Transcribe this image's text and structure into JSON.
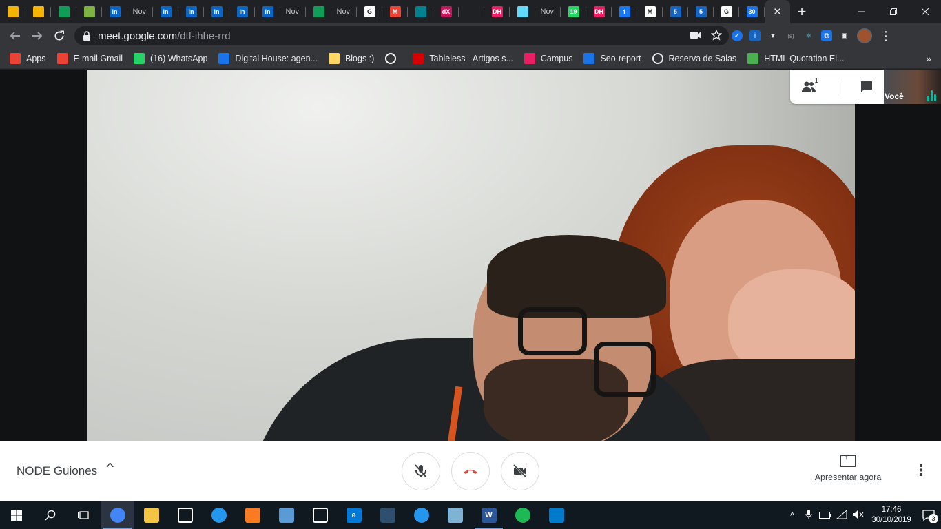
{
  "browser": {
    "tabs": [
      {
        "favicon": "slides-icon",
        "color": "#f4b400",
        "text": ""
      },
      {
        "favicon": "slides-icon",
        "color": "#f4b400",
        "text": ""
      },
      {
        "favicon": "drive-icon",
        "color": "#0f9d58",
        "text": ""
      },
      {
        "favicon": "shield-icon",
        "color": "#7cb342",
        "text": ""
      },
      {
        "favicon": "linkedin-icon",
        "color": "#0a66c2",
        "text": "in"
      },
      {
        "favicon": "none",
        "color": "",
        "text": "Nov"
      },
      {
        "favicon": "linkedin-icon",
        "color": "#0a66c2",
        "text": "in"
      },
      {
        "favicon": "linkedin-icon",
        "color": "#0a66c2",
        "text": "in"
      },
      {
        "favicon": "linkedin-icon",
        "color": "#0a66c2",
        "text": "in"
      },
      {
        "favicon": "linkedin-icon",
        "color": "#0a66c2",
        "text": "in"
      },
      {
        "favicon": "linkedin-icon",
        "color": "#0a66c2",
        "text": "in"
      },
      {
        "favicon": "none",
        "color": "",
        "text": "Nov"
      },
      {
        "favicon": "hangouts-icon",
        "color": "#0f9d58",
        "text": ""
      },
      {
        "favicon": "none",
        "color": "",
        "text": "Nov"
      },
      {
        "favicon": "google-icon",
        "color": "#ffffff",
        "text": "G"
      },
      {
        "favicon": "gmail-icon",
        "color": "#ea4335",
        "text": "M"
      },
      {
        "favicon": "chart-icon",
        "color": "#00838f",
        "text": ""
      },
      {
        "favicon": "edx-icon",
        "color": "#c2185b",
        "text": "dX"
      },
      {
        "favicon": "edit-icon",
        "color": "#202124",
        "text": ""
      },
      {
        "favicon": "dh-icon",
        "color": "#e91e63",
        "text": "DH"
      },
      {
        "favicon": "react-icon",
        "color": "#61dafb",
        "text": ""
      },
      {
        "favicon": "none",
        "color": "",
        "text": "Nov"
      },
      {
        "favicon": "whatsapp-icon",
        "color": "#25d366",
        "text": "19"
      },
      {
        "favicon": "dh-icon",
        "color": "#e91e63",
        "text": "DH"
      },
      {
        "favicon": "facebook-icon",
        "color": "#1877f2",
        "text": "f"
      },
      {
        "favicon": "medium-icon",
        "color": "#ffffff",
        "text": "M"
      },
      {
        "favicon": "doc-icon",
        "color": "#1565c0",
        "text": "5"
      },
      {
        "favicon": "doc-icon",
        "color": "#1565c0",
        "text": "5"
      },
      {
        "favicon": "google-icon",
        "color": "#ffffff",
        "text": "G"
      },
      {
        "favicon": "calendar-icon",
        "color": "#1a73e8",
        "text": "30"
      }
    ],
    "active_tab_close": "✕",
    "new_tab": "+",
    "url_host": "meet.google.com",
    "url_path": "/dtf-ihhe-rrd"
  },
  "bookmarks": [
    {
      "label": "Apps",
      "icon": "apps-grid-icon",
      "color": "#ea4335"
    },
    {
      "label": "E-mail Gmail",
      "icon": "gmail-icon",
      "color": "#ea4335"
    },
    {
      "label": "(16) WhatsApp",
      "icon": "whatsapp-icon",
      "color": "#25d366"
    },
    {
      "label": "Digital House: agen...",
      "icon": "calendar-icon",
      "color": "#1a73e8"
    },
    {
      "label": "Blogs :)",
      "icon": "folder-icon",
      "color": "#fdd663"
    },
    {
      "label": "",
      "icon": "google-icon",
      "color": "#ffffff"
    },
    {
      "label": "Tableless - Artigos s...",
      "icon": "star-icon",
      "color": "#d50000"
    },
    {
      "label": "Campus",
      "icon": "dh-icon",
      "color": "#e91e63"
    },
    {
      "label": "Seo-report",
      "icon": "seo-icon",
      "color": "#1a73e8"
    },
    {
      "label": "Reserva de Salas",
      "icon": "globe-icon",
      "color": "#e8eaed"
    },
    {
      "label": "HTML Quotation El...",
      "icon": "w3-icon",
      "color": "#4caf50"
    }
  ],
  "meet": {
    "participants_count": "1",
    "self_label": "Você",
    "meeting_name": "NODE Guiones",
    "present_label": "Apresentar agora",
    "hangup_color": "#ea4335"
  },
  "taskbar": {
    "apps": [
      {
        "name": "chrome",
        "color": "#4285f4",
        "text": "",
        "running": true,
        "active": true
      },
      {
        "name": "file-explorer",
        "color": "#f4c542",
        "text": "",
        "running": false,
        "active": false
      },
      {
        "name": "mail",
        "color": "#ffffff",
        "text": "",
        "running": false,
        "active": false
      },
      {
        "name": "docker",
        "color": "#2496ed",
        "text": "",
        "running": false,
        "active": false
      },
      {
        "name": "xampp",
        "color": "#fb7a24",
        "text": "",
        "running": false,
        "active": false
      },
      {
        "name": "remote-desktop",
        "color": "#5b9bd5",
        "text": "",
        "running": false,
        "active": false
      },
      {
        "name": "settings",
        "color": "#ffffff",
        "text": "",
        "running": false,
        "active": false
      },
      {
        "name": "edge",
        "color": "#0078d7",
        "text": "e",
        "running": false,
        "active": false
      },
      {
        "name": "mysql-workbench",
        "color": "#2f4f6f",
        "text": "",
        "running": false,
        "active": false
      },
      {
        "name": "docker",
        "color": "#2496ed",
        "text": "",
        "running": false,
        "active": false
      },
      {
        "name": "notes",
        "color": "#7fb3d5",
        "text": "",
        "running": false,
        "active": false
      },
      {
        "name": "word",
        "color": "#2b579a",
        "text": "W",
        "running": true,
        "active": false
      },
      {
        "name": "spotify",
        "color": "#1db954",
        "text": "",
        "running": false,
        "active": false
      },
      {
        "name": "vscode",
        "color": "#007acc",
        "text": "",
        "running": false,
        "active": false
      }
    ],
    "time": "17:46",
    "date": "30/10/2019",
    "notifications": "3"
  }
}
